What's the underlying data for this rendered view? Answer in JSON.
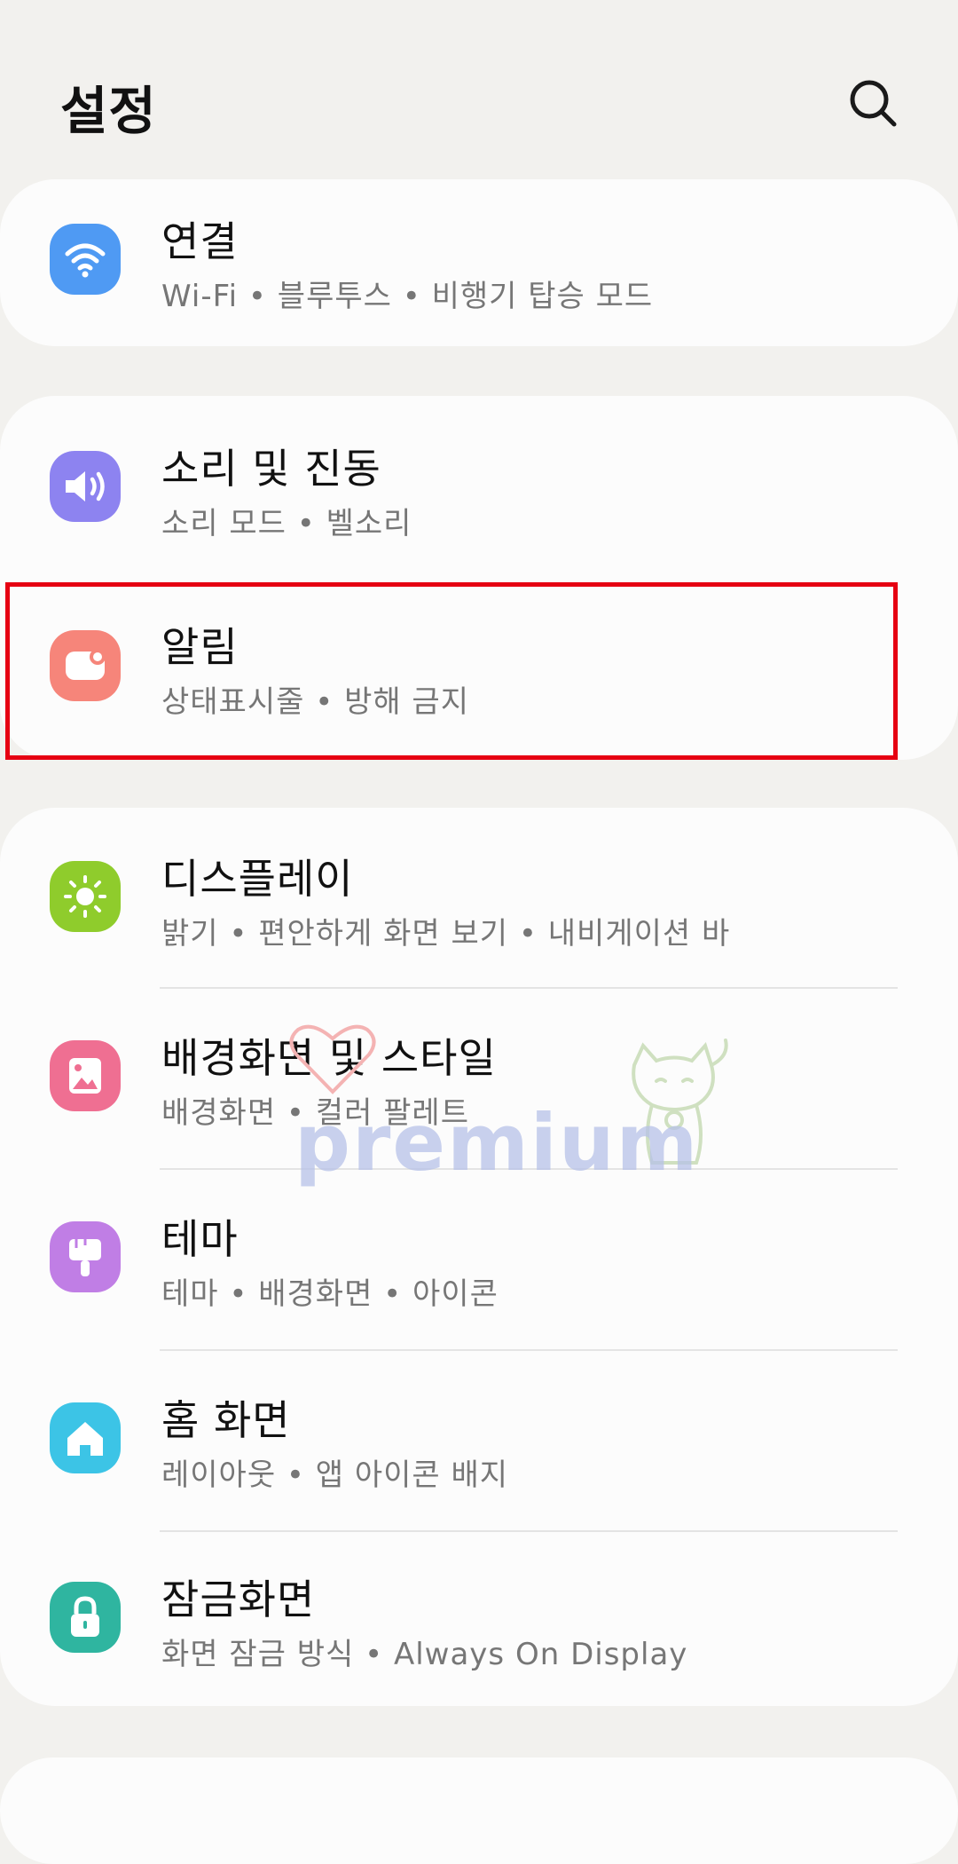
{
  "header": {
    "title": "설정",
    "search_icon": "search-icon"
  },
  "groups": [
    {
      "items": [
        {
          "id": "connections",
          "title": "연결",
          "subtitle": "Wi-Fi • 블루투스 • 비행기 탑승 모드",
          "icon": "wifi-icon",
          "color": "#4f9af3"
        }
      ]
    },
    {
      "items": [
        {
          "id": "sound",
          "title": "소리 및 진동",
          "subtitle": "소리 모드 • 벨소리",
          "icon": "volume-icon",
          "color": "#8d83f0"
        },
        {
          "id": "notifications",
          "title": "알림",
          "subtitle": "상태표시줄 • 방해 금지",
          "icon": "notification-icon",
          "color": "#f6857a"
        }
      ]
    },
    {
      "items": [
        {
          "id": "display",
          "title": "디스플레이",
          "subtitle": "밝기 • 편안하게 화면 보기 • 내비게이션 바",
          "icon": "brightness-icon",
          "color": "#8fcc2c"
        },
        {
          "id": "wallpaper",
          "title": "배경화면 및 스타일",
          "subtitle": "배경화면 • 컬러 팔레트",
          "icon": "wallpaper-icon",
          "color": "#ef6f92"
        },
        {
          "id": "themes",
          "title": "테마",
          "subtitle": "테마 • 배경화면 • 아이콘",
          "icon": "paintbrush-icon",
          "color": "#c07ee5"
        },
        {
          "id": "home",
          "title": "홈 화면",
          "subtitle": "레이아웃 • 앱 아이콘 배지",
          "icon": "home-icon",
          "color": "#3cc4e6"
        },
        {
          "id": "lockscreen",
          "title": "잠금화면",
          "subtitle": "화면 잠금 방식 • Always On Display",
          "icon": "lock-icon",
          "color": "#2fb5a0"
        }
      ]
    }
  ],
  "watermark": {
    "text": "premium"
  }
}
